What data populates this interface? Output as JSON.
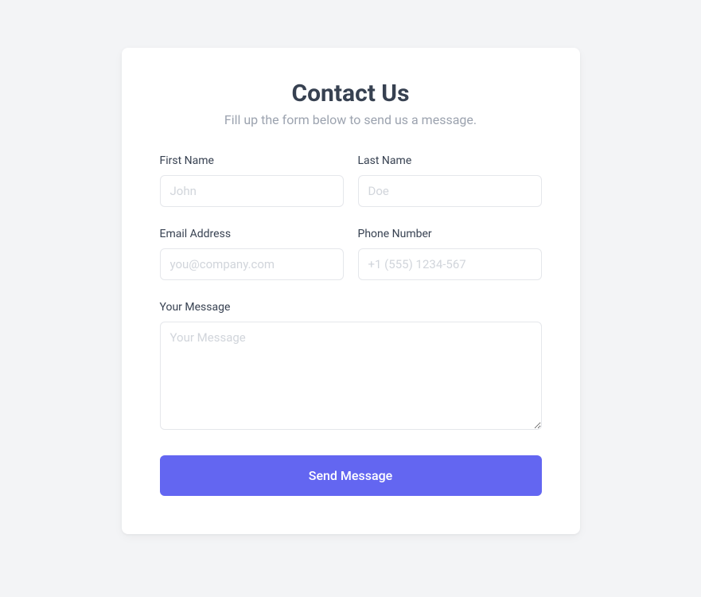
{
  "header": {
    "title": "Contact Us",
    "subtitle": "Fill up the form below to send us a message."
  },
  "form": {
    "first_name": {
      "label": "First Name",
      "placeholder": "John",
      "value": ""
    },
    "last_name": {
      "label": "Last Name",
      "placeholder": "Doe",
      "value": ""
    },
    "email": {
      "label": "Email Address",
      "placeholder": "you@company.com",
      "value": ""
    },
    "phone": {
      "label": "Phone Number",
      "placeholder": "+1 (555) 1234-567",
      "value": ""
    },
    "message": {
      "label": "Your Message",
      "placeholder": "Your Message",
      "value": ""
    },
    "submit_label": "Send Message"
  },
  "colors": {
    "accent": "#6366f1",
    "background": "#f3f4f6",
    "text": "#374151",
    "muted": "#9ca3af",
    "border": "#e5e7eb"
  }
}
